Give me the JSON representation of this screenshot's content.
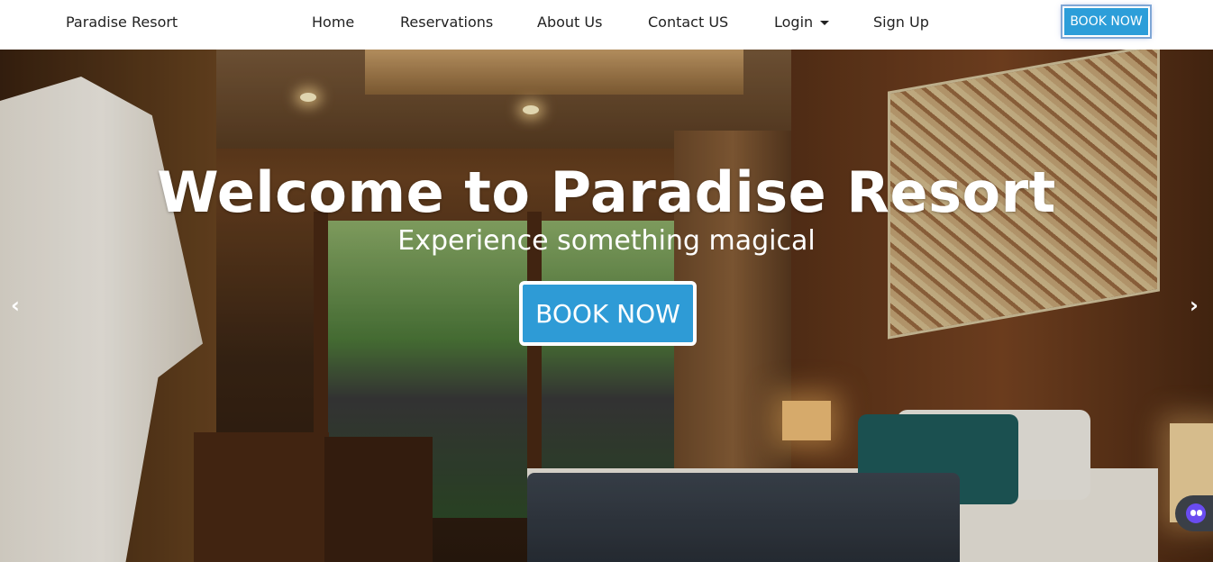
{
  "navbar": {
    "brand": "Paradise Resort",
    "links": [
      "Home",
      "Reservations",
      "About Us",
      "Contact US",
      "Login",
      "Sign Up"
    ],
    "book_button": "BOOK NOW"
  },
  "hero": {
    "title": "Welcome to Paradise Resort",
    "subtitle": "Experience something magical",
    "book_button": "BOOK NOW",
    "prev_arrow": "‹",
    "next_arrow": "›"
  },
  "colors": {
    "accent": "#2c9ed9",
    "nav_bg": "#ffffff",
    "text_dark": "#222222"
  },
  "icons": {
    "login_caret": "chevron-down-icon",
    "chat_widget": "chat-bot-icon"
  }
}
